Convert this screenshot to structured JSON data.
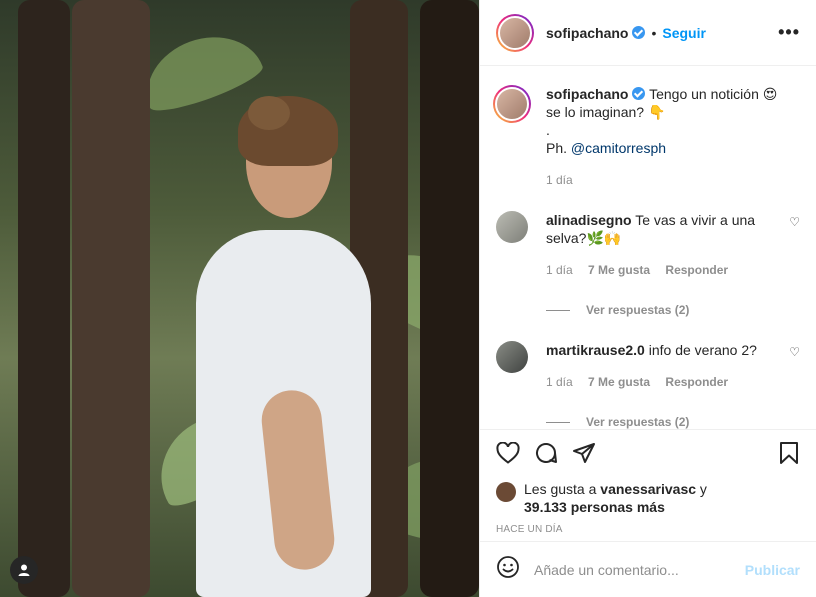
{
  "post": {
    "username": "sofipachano",
    "dot": "•",
    "follow_label": "Seguir",
    "more_label": "•••",
    "caption": {
      "line1": "Tengo un notición 😍",
      "line2": "se lo imaginan? 👇",
      "line3": ".",
      "line4_prefix": "Ph. ",
      "mention": "@camitorresph",
      "time": "1 día"
    }
  },
  "comments": [
    {
      "username": "alinadisegno",
      "text": "Te vas a vivir a una selva?🌿🙌",
      "time": "1 día",
      "likes": "7 Me gusta",
      "reply_label": "Responder",
      "view_replies": "Ver respuestas (2)"
    },
    {
      "username": "martikrause2.0",
      "text": "info de verano 2?",
      "time": "1 día",
      "likes": "7 Me gusta",
      "reply_label": "Responder",
      "view_replies": "Ver respuestas (2)"
    }
  ],
  "likes_summary": {
    "prefix": "Les gusta a ",
    "user": "vanessarivasc",
    "suffix": " y",
    "count": "39.133 personas más"
  },
  "posted_time": "HACE UN DÍA",
  "add_comment": {
    "placeholder": "Añade un comentario...",
    "publish_label": "Publicar"
  },
  "icons": {
    "like": "heart-icon",
    "comment": "comment-icon",
    "share": "share-icon",
    "save": "bookmark-icon",
    "emoji": "emoji-icon",
    "user_tag": "user-tag-icon"
  },
  "colors": {
    "accent": "#0095f6",
    "verified": "#3897f0",
    "muted": "#8e8e8e",
    "publish_disabled": "#b2dffc"
  }
}
